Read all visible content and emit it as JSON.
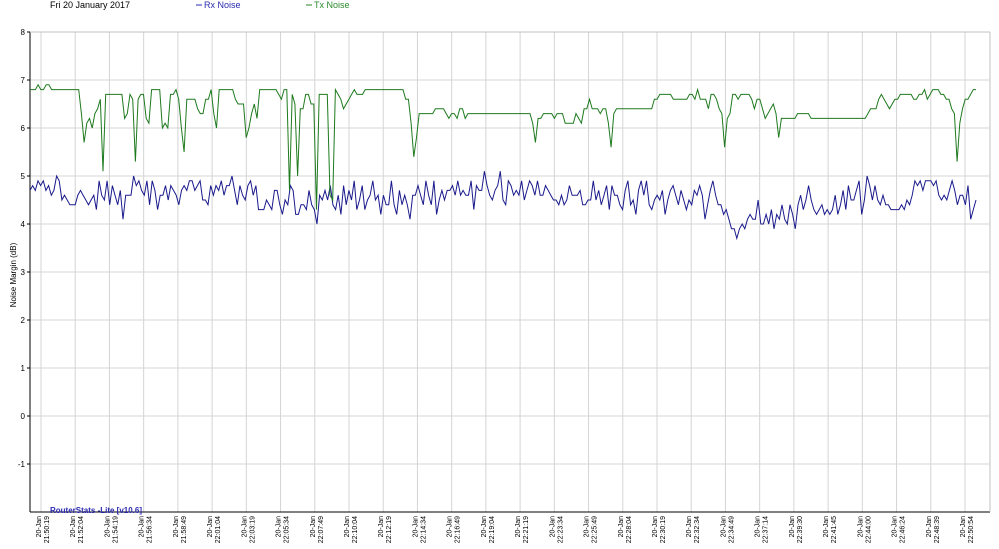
{
  "header": {
    "date": "Fri 20 January 2017"
  },
  "watermark": "RouterStats -Lite [v10.6]",
  "colors": {
    "rx": "#1a1a8c",
    "tx": "#1e7a1e",
    "grid": "#d4d4d4",
    "axis": "#000000",
    "legend_rx": "#2a2ab0",
    "legend_tx": "#2a8a2a",
    "watermark": "#2a2ab0"
  },
  "chart_data": {
    "type": "line",
    "title": "",
    "ylabel": "Noise Margin (dB)",
    "xlabel": "",
    "ylim": [
      -2,
      8
    ],
    "yticks": [
      -1,
      0,
      1,
      2,
      3,
      4,
      5,
      6,
      7,
      8
    ],
    "grid": true,
    "legend_position": "top",
    "x_tick_date": "20-Jan",
    "x_tick_times": [
      "21:50:19",
      "21:52:04",
      "21:54:19",
      "21:56:34",
      "21:58:49",
      "22:01:04",
      "22:03:19",
      "22:05:34",
      "22:07:49",
      "22:10:04",
      "22:12:19",
      "22:14:34",
      "22:16:49",
      "22:19:04",
      "22:21:19",
      "22:23:34",
      "22:25:49",
      "22:28:04",
      "22:30:19",
      "22:32:34",
      "22:34:49",
      "22:37:14",
      "22:39:30",
      "22:41:45",
      "22:44:00",
      "22:46:24",
      "22:48:39",
      "22:50:54"
    ],
    "series": [
      {
        "name": "Rx Noise",
        "values": [
          4.7,
          4.8,
          4.7,
          4.9,
          4.8,
          4.9,
          4.7,
          4.8,
          4.6,
          4.7,
          5.0,
          4.9,
          4.5,
          4.6,
          4.5,
          4.4,
          4.4,
          4.4,
          4.6,
          4.7,
          4.6,
          4.5,
          4.4,
          4.5,
          4.6,
          4.3,
          4.9,
          4.6,
          4.5,
          4.9,
          4.4,
          4.8,
          4.6,
          4.4,
          4.7,
          4.1,
          4.6,
          4.6,
          4.6,
          5.0,
          4.8,
          4.9,
          4.7,
          4.6,
          4.9,
          4.4,
          4.9,
          4.7,
          4.3,
          4.6,
          4.6,
          4.8,
          4.5,
          4.8,
          4.7,
          4.6,
          4.4,
          4.7,
          4.8,
          4.7,
          4.9,
          4.9,
          4.7,
          4.8,
          4.9,
          4.5,
          4.5,
          4.4,
          4.8,
          4.6,
          4.8,
          4.7,
          4.9,
          4.6,
          4.8,
          4.8,
          5.0,
          4.7,
          4.4,
          4.8,
          4.6,
          4.5,
          4.8,
          4.9,
          4.6,
          4.8,
          4.3,
          4.3,
          4.3,
          4.5,
          4.4,
          4.3,
          4.7,
          4.7,
          4.4,
          4.2,
          4.5,
          4.4,
          4.8,
          4.7,
          4.2,
          4.2,
          4.4,
          4.4,
          4.3,
          4.7,
          4.4,
          4.3,
          4.0,
          4.6,
          4.5,
          4.7,
          4.5,
          4.8,
          4.4,
          4.3,
          4.6,
          4.2,
          4.8,
          4.4,
          4.7,
          4.5,
          4.9,
          4.3,
          4.5,
          4.8,
          4.3,
          4.5,
          4.6,
          4.9,
          4.5,
          4.6,
          4.2,
          4.6,
          4.4,
          4.4,
          4.9,
          4.4,
          4.2,
          4.7,
          4.4,
          4.6,
          4.4,
          4.1,
          4.6,
          4.6,
          4.8,
          4.6,
          4.4,
          4.9,
          4.6,
          4.4,
          4.9,
          4.2,
          4.5,
          4.7,
          4.5,
          4.7,
          4.7,
          4.8,
          4.6,
          4.9,
          4.6,
          4.7,
          4.6,
          4.6,
          4.9,
          4.3,
          4.8,
          4.7,
          4.7,
          5.1,
          4.8,
          4.6,
          4.5,
          4.7,
          4.8,
          5.1,
          4.5,
          4.4,
          4.9,
          4.8,
          4.6,
          4.7,
          4.6,
          4.9,
          4.5,
          4.7,
          4.9,
          4.8,
          4.6,
          4.9,
          4.6,
          4.6,
          4.8,
          4.7,
          4.6,
          4.5,
          4.5,
          4.4,
          4.6,
          4.4,
          4.5,
          4.8,
          4.6,
          4.6,
          4.6,
          4.7,
          4.4,
          4.4,
          4.5,
          4.5,
          4.9,
          4.5,
          4.7,
          4.4,
          4.6,
          4.8,
          4.3,
          4.8,
          4.6,
          4.6,
          4.4,
          4.3,
          4.7,
          4.9,
          4.4,
          4.5,
          4.2,
          4.7,
          4.9,
          4.6,
          4.9,
          4.4,
          4.3,
          4.5,
          4.6,
          4.5,
          4.7,
          4.2,
          4.5,
          4.7,
          4.8,
          4.6,
          4.4,
          4.7,
          4.5,
          4.3,
          4.5,
          4.4,
          4.7,
          4.6,
          4.8,
          4.6,
          4.1,
          4.4,
          4.7,
          4.9,
          4.6,
          4.4,
          4.4,
          4.2,
          4.3,
          4.1,
          3.9,
          3.9,
          3.7,
          3.9,
          4.0,
          3.9,
          4.1,
          4.2,
          4.1,
          4.1,
          4.5,
          4.0,
          4.0,
          4.2,
          4.0,
          4.3,
          3.9,
          4.2,
          4.1,
          4.4,
          4.1,
          4.0,
          4.4,
          4.2,
          3.9,
          4.4,
          4.6,
          4.3,
          4.5,
          4.8,
          4.5,
          4.3,
          4.2,
          4.3,
          4.4,
          4.2,
          4.3,
          4.2,
          4.3,
          4.6,
          4.2,
          4.4,
          4.7,
          4.3,
          4.8,
          4.5,
          4.5,
          4.7,
          4.9,
          4.2,
          4.5,
          5.0,
          4.8,
          4.5,
          4.8,
          4.5,
          4.4,
          4.6,
          4.4,
          4.4,
          4.3,
          4.3,
          4.3,
          4.3,
          4.4,
          4.3,
          4.5,
          4.4,
          4.6,
          4.9,
          4.8,
          4.9,
          4.7,
          4.9,
          4.9,
          4.9,
          4.8,
          4.9,
          4.6,
          4.5,
          4.6,
          4.5,
          4.7,
          4.9,
          4.7,
          4.4,
          4.6,
          4.6,
          4.4,
          4.8,
          4.1,
          4.3,
          4.5
        ]
      },
      {
        "name": "Tx Noise",
        "values": [
          6.8,
          6.8,
          6.8,
          6.9,
          6.8,
          6.8,
          6.9,
          6.9,
          6.8,
          6.8,
          6.8,
          6.8,
          6.8,
          6.8,
          6.8,
          6.8,
          6.8,
          6.8,
          6.8,
          6.3,
          5.7,
          6.1,
          6.2,
          6.0,
          6.3,
          6.4,
          6.6,
          5.1,
          6.7,
          6.7,
          6.7,
          6.7,
          6.7,
          6.7,
          6.7,
          6.2,
          6.3,
          6.7,
          6.6,
          5.3,
          6.6,
          6.7,
          6.7,
          6.2,
          6.1,
          6.8,
          6.8,
          6.8,
          6.8,
          6.0,
          6.1,
          6.0,
          6.7,
          6.7,
          6.8,
          6.6,
          6.0,
          5.5,
          6.6,
          6.6,
          6.6,
          6.6,
          6.4,
          6.3,
          6.3,
          6.6,
          6.6,
          6.8,
          6.3,
          6.0,
          6.8,
          6.8,
          6.8,
          6.8,
          6.8,
          6.8,
          6.6,
          6.5,
          6.5,
          6.5,
          5.8,
          6.0,
          6.3,
          6.5,
          6.2,
          6.8,
          6.8,
          6.8,
          6.8,
          6.8,
          6.8,
          6.8,
          6.7,
          6.6,
          6.8,
          6.8,
          4.7,
          6.7,
          6.5,
          5.0,
          6.4,
          6.4,
          6.7,
          6.7,
          6.5,
          6.5,
          4.3,
          6.7,
          6.7,
          6.7,
          6.7,
          4.6,
          4.5,
          6.8,
          6.7,
          6.6,
          6.4,
          6.5,
          6.6,
          6.7,
          6.8,
          6.7,
          6.7,
          6.7,
          6.8,
          6.8,
          6.8,
          6.8,
          6.8,
          6.8,
          6.8,
          6.8,
          6.8,
          6.8,
          6.8,
          6.8,
          6.8,
          6.8,
          6.8,
          6.6,
          6.6,
          6.1,
          5.4,
          5.8,
          6.3,
          6.3,
          6.3,
          6.3,
          6.3,
          6.3,
          6.4,
          6.4,
          6.4,
          6.4,
          6.3,
          6.2,
          6.3,
          6.3,
          6.2,
          6.4,
          6.4,
          6.2,
          6.3,
          6.3,
          6.3,
          6.3,
          6.3,
          6.3,
          6.3,
          6.3,
          6.3,
          6.3,
          6.3,
          6.3,
          6.3,
          6.3,
          6.3,
          6.3,
          6.3,
          6.3,
          6.3,
          6.3,
          6.3,
          6.3,
          6.3,
          6.3,
          6.1,
          5.7,
          6.2,
          6.2,
          6.3,
          6.3,
          6.3,
          6.3,
          6.2,
          6.3,
          6.3,
          6.3,
          6.1,
          6.1,
          6.1,
          6.1,
          6.3,
          6.2,
          6.1,
          6.4,
          6.4,
          6.6,
          6.4,
          6.4,
          6.4,
          6.3,
          6.4,
          6.4,
          6.1,
          5.6,
          6.3,
          6.4,
          6.4,
          6.4,
          6.4,
          6.4,
          6.4,
          6.4,
          6.4,
          6.4,
          6.4,
          6.4,
          6.4,
          6.4,
          6.4,
          6.6,
          6.6,
          6.7,
          6.7,
          6.7,
          6.7,
          6.7,
          6.6,
          6.6,
          6.6,
          6.6,
          6.6,
          6.6,
          6.7,
          6.7,
          6.6,
          6.8,
          6.6,
          6.6,
          6.6,
          6.4,
          6.7,
          6.7,
          6.6,
          6.4,
          6.3,
          5.6,
          6.2,
          6.3,
          6.7,
          6.7,
          6.6,
          6.7,
          6.7,
          6.7,
          6.7,
          6.6,
          6.4,
          6.6,
          6.6,
          6.4,
          6.2,
          6.3,
          6.4,
          6.5,
          6.3,
          5.8,
          6.2,
          6.2,
          6.2,
          6.2,
          6.2,
          6.2,
          6.3,
          6.3,
          6.3,
          6.3,
          6.3,
          6.2,
          6.2,
          6.2,
          6.2,
          6.2,
          6.2,
          6.2,
          6.2,
          6.2,
          6.2,
          6.2,
          6.2,
          6.2,
          6.2,
          6.2,
          6.2,
          6.2,
          6.2,
          6.2,
          6.2,
          6.2,
          6.3,
          6.4,
          6.4,
          6.4,
          6.6,
          6.7,
          6.6,
          6.5,
          6.4,
          6.5,
          6.6,
          6.6,
          6.7,
          6.7,
          6.7,
          6.7,
          6.7,
          6.6,
          6.6,
          6.7,
          6.7,
          6.8,
          6.6,
          6.7,
          6.8,
          6.8,
          6.8,
          6.7,
          6.7,
          6.6,
          6.6,
          6.4,
          6.3,
          5.3,
          6.1,
          6.4,
          6.6,
          6.6,
          6.7,
          6.8,
          6.8
        ]
      }
    ]
  }
}
